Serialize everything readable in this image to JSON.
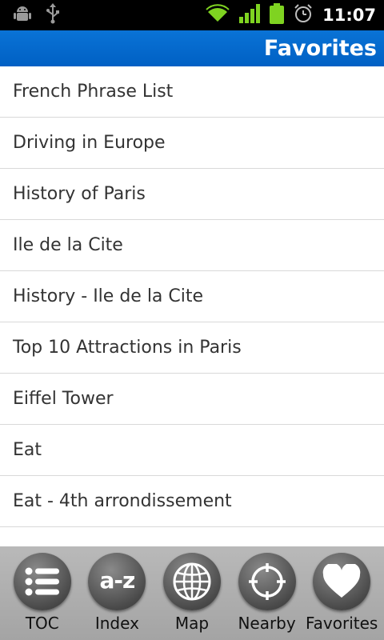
{
  "status_bar": {
    "time": "11:07",
    "icons": [
      "android-debug-icon",
      "usb-icon",
      "wifi-icon",
      "signal-icon",
      "battery-icon",
      "alarm-icon"
    ]
  },
  "title_bar": {
    "title": "Favorites",
    "color": "#0066cc"
  },
  "favorites": [
    "French Phrase List",
    "Driving in Europe",
    "History of Paris",
    "Ile de la Cite",
    "History - Ile de la Cite",
    "Top 10 Attractions in Paris",
    "Eiffel Tower",
    "Eat",
    "Eat - 4th arrondissement"
  ],
  "bottom_nav": {
    "items": [
      {
        "label": "TOC",
        "icon": "list-icon"
      },
      {
        "label": "Index",
        "icon": "a-z-icon",
        "icon_text": "a-z"
      },
      {
        "label": "Map",
        "icon": "globe-icon"
      },
      {
        "label": "Nearby",
        "icon": "crosshair-icon"
      },
      {
        "label": "Favorites",
        "icon": "heart-icon"
      }
    ]
  }
}
